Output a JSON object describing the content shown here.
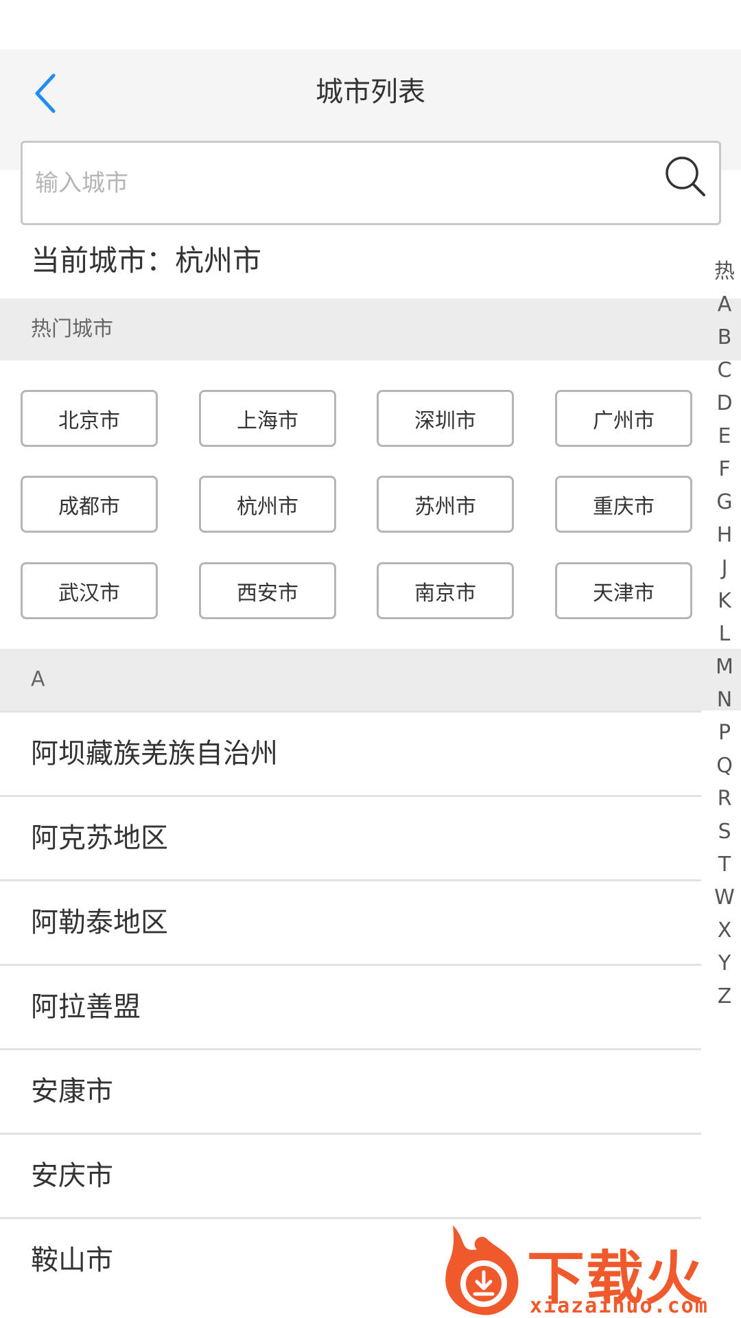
{
  "header": {
    "title": "城市列表",
    "back_icon": "chevron-left-icon"
  },
  "search": {
    "placeholder": "输入城市",
    "value": "",
    "icon": "search-icon"
  },
  "current_city": {
    "text": "当前城市：杭州市"
  },
  "hot_section": {
    "label": "热门城市",
    "cities": [
      "北京市",
      "上海市",
      "深圳市",
      "广州市",
      "成都市",
      "杭州市",
      "苏州市",
      "重庆市",
      "武汉市",
      "西安市",
      "南京市",
      "天津市"
    ]
  },
  "list_section": {
    "label": "A",
    "cities": [
      "阿坝藏族羌族自治州",
      "阿克苏地区",
      "阿勒泰地区",
      "阿拉善盟",
      "安康市",
      "安庆市",
      "鞍山市"
    ]
  },
  "index_bar": [
    "热",
    "A",
    "B",
    "C",
    "D",
    "E",
    "F",
    "G",
    "H",
    "J",
    "K",
    "L",
    "M",
    "N",
    "P",
    "Q",
    "R",
    "S",
    "T",
    "W",
    "X",
    "Y",
    "Z"
  ],
  "watermark": {
    "text": "下载火",
    "url": "xiazaihuo.com"
  },
  "colors": {
    "accent": "#1e8ff0",
    "section_bg": "#ececec",
    "nav_bg": "#f5f5f5",
    "watermark": "#f0592b"
  }
}
